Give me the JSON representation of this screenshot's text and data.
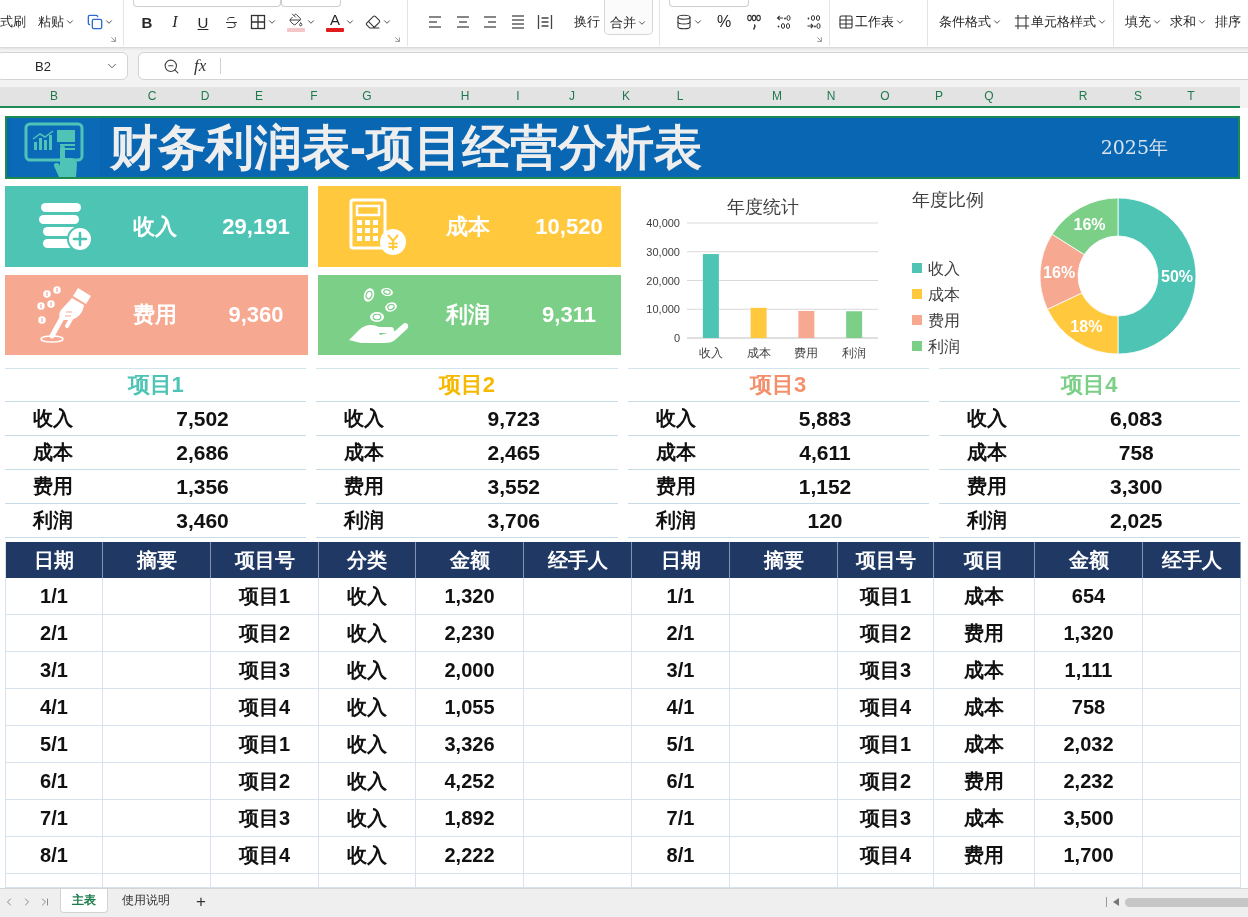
{
  "ribbon": {
    "format_painter": "式刷",
    "paste": "粘贴",
    "bold": "B",
    "italic": "I",
    "underline": "U",
    "font_color": "A",
    "wrap_text": "换行",
    "merge": "合并",
    "percent": "%",
    "worksheet": "工作表",
    "conditional_format": "条件格式",
    "cell_style": "单元格样式",
    "fill": "填充",
    "sum": "求和",
    "sort": "排序"
  },
  "formula_bar": {
    "name_box": "B2",
    "function_label": "fx"
  },
  "column_headers": [
    "B",
    "C",
    "D",
    "E",
    "F",
    "G",
    "H",
    "I",
    "J",
    "K",
    "L",
    "M",
    "N",
    "O",
    "P",
    "Q",
    "R",
    "S",
    "T"
  ],
  "title_banner": {
    "title": "财务利润表-项目经营分析表",
    "year": "2025年"
  },
  "kpis": [
    {
      "label": "收入",
      "value": "29,191",
      "color": "#4ec4b4"
    },
    {
      "label": "成本",
      "value": "10,520",
      "color": "#ffc83d"
    },
    {
      "label": "费用",
      "value": "9,360",
      "color": "#f7a891"
    },
    {
      "label": "利润",
      "value": "9,311",
      "color": "#7ccf87"
    }
  ],
  "bar_chart": {
    "chart_data": {
      "type": "bar",
      "title": "年度统计",
      "categories": [
        "收入",
        "成本",
        "费用",
        "利润"
      ],
      "values": [
        29200,
        10500,
        9400,
        9300
      ],
      "colors": [
        "#4ec4b4",
        "#ffc83d",
        "#f7a891",
        "#7ccf87"
      ],
      "ylim": [
        0,
        40000
      ],
      "yticks": [
        {
          "value": 0,
          "label": "0"
        },
        {
          "value": 10000,
          "label": "10,000"
        },
        {
          "value": 20000,
          "label": "20,000"
        },
        {
          "value": 30000,
          "label": "30,000"
        },
        {
          "value": 40000,
          "label": "40,000"
        }
      ],
      "grid": true
    }
  },
  "donut_chart": {
    "chart_data": {
      "type": "donut",
      "title": "年度比例",
      "categories": [
        "收入",
        "成本",
        "费用",
        "利润"
      ],
      "values": [
        50,
        18,
        16,
        16
      ],
      "colors": [
        "#4ec4b4",
        "#ffc83d",
        "#f7a891",
        "#7ccf87"
      ],
      "value_labels": [
        "50%",
        "18%",
        "16%",
        "16%"
      ],
      "legend": "left"
    }
  },
  "projects": [
    {
      "title": "项目1",
      "color": "#4ec4b4",
      "rows": [
        {
          "label": "收入",
          "value": "7,502"
        },
        {
          "label": "成本",
          "value": "2,686"
        },
        {
          "label": "费用",
          "value": "1,356"
        },
        {
          "label": "利润",
          "value": "3,460"
        }
      ]
    },
    {
      "title": "项目2",
      "color": "#f7b900",
      "rows": [
        {
          "label": "收入",
          "value": "9,723"
        },
        {
          "label": "成本",
          "value": "2,465"
        },
        {
          "label": "费用",
          "value": "3,552"
        },
        {
          "label": "利润",
          "value": "3,706"
        }
      ]
    },
    {
      "title": "项目3",
      "color": "#f3906b",
      "rows": [
        {
          "label": "收入",
          "value": "5,883"
        },
        {
          "label": "成本",
          "value": "4,611"
        },
        {
          "label": "费用",
          "value": "1,152"
        },
        {
          "label": "利润",
          "value": "120"
        }
      ]
    },
    {
      "title": "项目4",
      "color": "#7ccf87",
      "rows": [
        {
          "label": "收入",
          "value": "6,083"
        },
        {
          "label": "成本",
          "value": "758"
        },
        {
          "label": "费用",
          "value": "3,300"
        },
        {
          "label": "利润",
          "value": "2,025"
        }
      ]
    }
  ],
  "ledger": {
    "columns": [
      "日期",
      "摘要",
      "项目号",
      "分类",
      "金额",
      "经手人",
      "日期",
      "摘要",
      "项目号",
      "项目",
      "金额",
      "经手人"
    ],
    "rows": [
      {
        "date": "1/1",
        "project_no": "项目1",
        "category": "收入",
        "amount": "1,320",
        "date_2": "1/1",
        "project_no_2": "项目1",
        "category_2": "成本",
        "amount_2": "654"
      },
      {
        "date": "2/1",
        "project_no": "项目2",
        "category": "收入",
        "amount": "2,230",
        "date_2": "2/1",
        "project_no_2": "项目2",
        "category_2": "费用",
        "amount_2": "1,320"
      },
      {
        "date": "3/1",
        "project_no": "项目3",
        "category": "收入",
        "amount": "2,000",
        "date_2": "3/1",
        "project_no_2": "项目3",
        "category_2": "成本",
        "amount_2": "1,111"
      },
      {
        "date": "4/1",
        "project_no": "项目4",
        "category": "收入",
        "amount": "1,055",
        "date_2": "4/1",
        "project_no_2": "项目4",
        "category_2": "成本",
        "amount_2": "758"
      },
      {
        "date": "5/1",
        "project_no": "项目1",
        "category": "收入",
        "amount": "3,326",
        "date_2": "5/1",
        "project_no_2": "项目1",
        "category_2": "成本",
        "amount_2": "2,032"
      },
      {
        "date": "6/1",
        "project_no": "项目2",
        "category": "收入",
        "amount": "4,252",
        "date_2": "6/1",
        "project_no_2": "项目2",
        "category_2": "费用",
        "amount_2": "2,232"
      },
      {
        "date": "7/1",
        "project_no": "项目3",
        "category": "收入",
        "amount": "1,892",
        "date_2": "7/1",
        "project_no_2": "项目3",
        "category_2": "成本",
        "amount_2": "3,500"
      },
      {
        "date": "8/1",
        "project_no": "项目4",
        "category": "收入",
        "amount": "2,222",
        "date_2": "8/1",
        "project_no_2": "项目4",
        "category_2": "费用",
        "amount_2": "1,700"
      }
    ]
  },
  "sheet_tabs": [
    {
      "label": "主表",
      "selected": true
    },
    {
      "label": "使用说明",
      "selected": false
    }
  ],
  "add_sheet": "+"
}
